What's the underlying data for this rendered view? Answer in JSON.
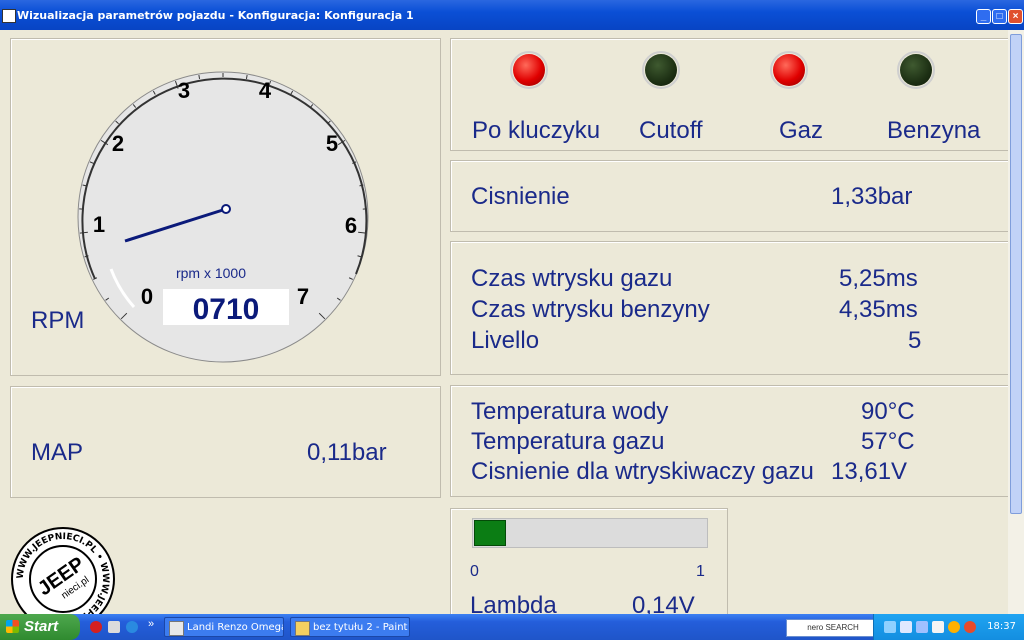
{
  "window": {
    "title": "Wizualizacja parametrów pojazdu - Konfiguracja: Konfiguracja 1",
    "buttons": {
      "minimize": "_",
      "maximize": "□",
      "close": "×"
    }
  },
  "rpm_gauge": {
    "label": "RPM",
    "unit_caption": "rpm x 1000",
    "digital_value": "0710",
    "value_rpm": 710,
    "dial_numbers": [
      "0",
      "1",
      "2",
      "3",
      "4",
      "5",
      "6",
      "7"
    ],
    "colors": {
      "needle": "#0b1a7a",
      "face": "#e6e6e6",
      "digits": "#0b1a7a"
    }
  },
  "map": {
    "label": "MAP",
    "value": "0,11bar"
  },
  "indicators": [
    {
      "label": "Po kluczyku",
      "state": "on",
      "color": "#e00000"
    },
    {
      "label": "Cutoff",
      "state": "off",
      "color": "#1d3014"
    },
    {
      "label": "Gaz",
      "state": "on",
      "color": "#e00000"
    },
    {
      "label": "Benzyna",
      "state": "off",
      "color": "#1d3014"
    }
  ],
  "pressure": {
    "label": "Cisnienie",
    "value": "1,33bar"
  },
  "injection": {
    "rows": [
      {
        "label": "Czas wtrysku gazu",
        "value": "5,25ms"
      },
      {
        "label": "Czas wtrysku benzyny",
        "value": "4,35ms"
      },
      {
        "label": "Livello",
        "value": "5"
      }
    ]
  },
  "temps": {
    "rows": [
      {
        "label": "Temperatura wody",
        "value": "90°C"
      },
      {
        "label": "Temperatura gazu",
        "value": "57°C"
      },
      {
        "label": "Cisnienie dla wtryskiwaczy gazu",
        "value": "13,61V"
      }
    ]
  },
  "lambda": {
    "label": "Lambda",
    "value": "0,14V",
    "min_label": "0",
    "max_label": "1",
    "level": 0.14,
    "color": "#0b7d14"
  },
  "watermark": {
    "text": "WWW.JEEPNIECI.PL",
    "brand": "JEEP",
    "sub": "nieci.pl"
  },
  "taskbar": {
    "start_label": "Start",
    "tasks": [
      {
        "label": "Landi Renzo Omegas"
      },
      {
        "label": "bez tytułu 2 - Paint"
      }
    ],
    "search_brand": "nero SEARCH",
    "clock": "18:37"
  },
  "theme": {
    "accent_text": "#1a2a8a",
    "background": "#ece9d8",
    "titlebar": "#0a4fd6"
  }
}
